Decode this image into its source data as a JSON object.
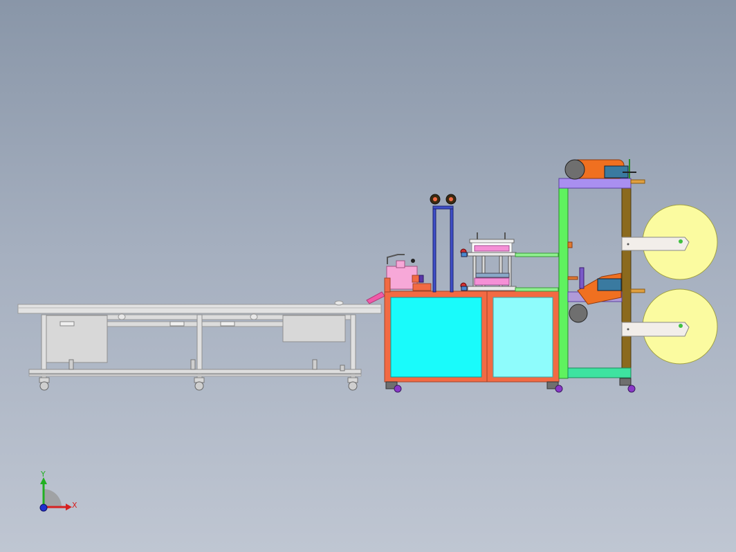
{
  "viewport": {
    "background_top": "#8996a8",
    "background_bottom": "#bfc6d2"
  },
  "axis_triad": {
    "x_label": "X",
    "y_label": "Y",
    "x_color": "#d62020",
    "y_color": "#22b022",
    "z_color": "#2030d0"
  },
  "colors": {
    "conveyor": "#e2e2e2",
    "frame_orange": "#f26a43",
    "panel_cyan": "#19fbfb",
    "panel_light_cyan": "#8efcfc",
    "stand_green": "#5ff25f",
    "stand_brown": "#8b6a1e",
    "top_bar_purple": "#a98ff0",
    "roll_yellow": "#fbfba0",
    "post_blue": "#3f4fc8",
    "die_pink": "#f58fd6",
    "caster_purple": "#8a38c8"
  }
}
